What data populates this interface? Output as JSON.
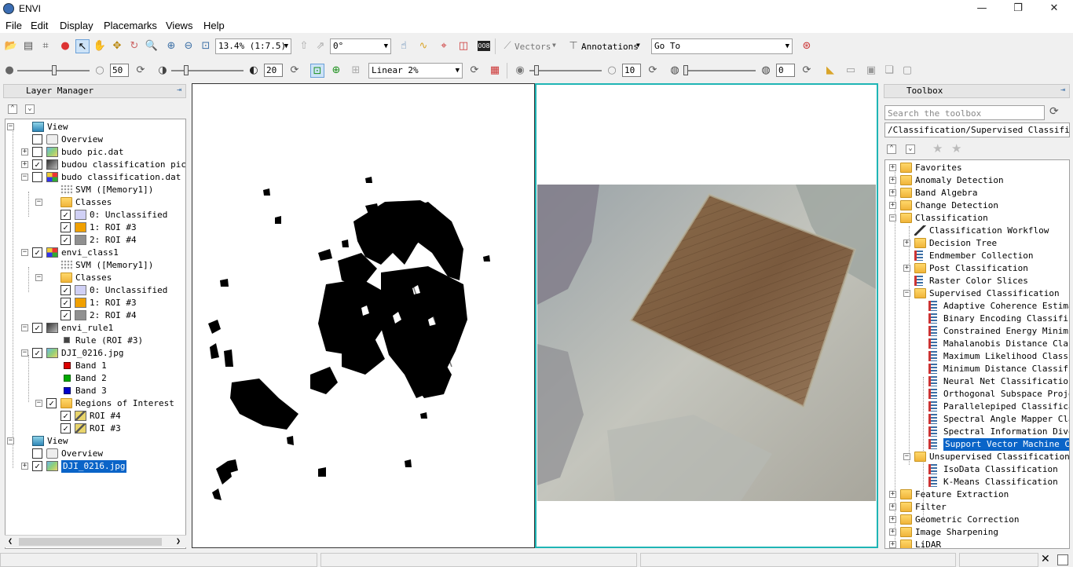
{
  "window": {
    "title": "ENVI",
    "minimize": "—",
    "maximize": "❐",
    "close": "✕"
  },
  "menu": [
    "File",
    "Edit",
    "Display",
    "Placemarks",
    "Views",
    "Help"
  ],
  "toolbar1": {
    "zoom_value": "13.4% (1:7.5)",
    "rotation_value": "0°",
    "vectors_label": "Vectors",
    "annotations_label": "Annotations",
    "goto_value": "Go To"
  },
  "toolbar2": {
    "brightness": "50",
    "contrast": "20",
    "stretch_value": "Linear 2%",
    "sharpen": "10",
    "transparency": "0"
  },
  "layer_manager": {
    "title": "Layer Manager",
    "nodes": [
      {
        "label": "View"
      },
      {
        "label": "Overview"
      },
      {
        "label": "budo pic.dat"
      },
      {
        "label": "budou classification pic.d"
      },
      {
        "label": "budo classification.dat"
      },
      {
        "label": "SVM ([Memory1])"
      },
      {
        "label": "Classes"
      },
      {
        "label": "0: Unclassified"
      },
      {
        "label": "1: ROI #3"
      },
      {
        "label": "2: ROI #4"
      },
      {
        "label": "envi_class1"
      },
      {
        "label": "SVM ([Memory1])"
      },
      {
        "label": "Classes"
      },
      {
        "label": "0: Unclassified"
      },
      {
        "label": "1: ROI #3"
      },
      {
        "label": "2: ROI #4"
      },
      {
        "label": "envi_rule1"
      },
      {
        "label": "Rule (ROI #3)"
      },
      {
        "label": "DJI_0216.jpg"
      },
      {
        "label": "Band 1"
      },
      {
        "label": "Band 2"
      },
      {
        "label": "Band 3"
      },
      {
        "label": "Regions of Interest"
      },
      {
        "label": "ROI #4"
      },
      {
        "label": "ROI #3"
      },
      {
        "label": "View"
      },
      {
        "label": "Overview"
      },
      {
        "label": "DJI_0216.jpg"
      }
    ]
  },
  "toolbox": {
    "title": "Toolbox",
    "search_placeholder": "Search the toolbox",
    "path": "/Classification/Supervised Classification",
    "nodes": [
      {
        "label": "Favorites"
      },
      {
        "label": "Anomaly Detection"
      },
      {
        "label": "Band Algebra"
      },
      {
        "label": "Change Detection"
      },
      {
        "label": "Classification"
      },
      {
        "label": "Classification Workflow"
      },
      {
        "label": "Decision Tree"
      },
      {
        "label": "Endmember Collection"
      },
      {
        "label": "Post Classification"
      },
      {
        "label": "Raster Color Slices"
      },
      {
        "label": "Supervised Classification"
      },
      {
        "label": "Adaptive Coherence Estima"
      },
      {
        "label": "Binary Encoding Classific"
      },
      {
        "label": "Constrained Energy Minimi"
      },
      {
        "label": "Mahalanobis Distance Clas"
      },
      {
        "label": "Maximum Likelihood Classi"
      },
      {
        "label": "Minimum Distance Classifi"
      },
      {
        "label": "Neural Net Classification"
      },
      {
        "label": "Orthogonal Subspace Proje"
      },
      {
        "label": "Parallelepiped Classifica"
      },
      {
        "label": "Spectral Angle Mapper Cla"
      },
      {
        "label": "Spectral Information Dive"
      },
      {
        "label": "Support Vector Machine Cl"
      },
      {
        "label": "Unsupervised Classification"
      },
      {
        "label": "IsoData Classification"
      },
      {
        "label": "K-Means Classification"
      },
      {
        "label": "Feature Extraction"
      },
      {
        "label": "Filter"
      },
      {
        "label": "Geometric Correction"
      },
      {
        "label": "Image Sharpening"
      },
      {
        "label": "LiDAR"
      }
    ]
  },
  "colors": {
    "selection": "#0a64c8",
    "active_view_border": "#1fb5b5"
  }
}
